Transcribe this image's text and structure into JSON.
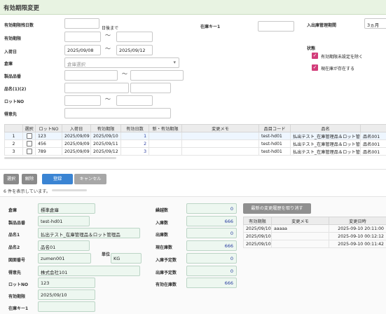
{
  "title": "有効期限変更",
  "search": {
    "remaining_days_label": "有効期限残日数",
    "remaining_days_value": "",
    "remaining_days_suffix": "日後まで",
    "expiry_label": "有効期限",
    "expiry_from": "",
    "expiry_to": "",
    "arrival_label": "入荷日",
    "arrival_from": "2025/09/08",
    "arrival_to": "2025/09/12",
    "warehouse_label": "倉庫",
    "warehouse_placeholder": "倉庫選択",
    "product_code_label": "製品品番",
    "product_name_label": "品名(1)(2)",
    "lot_label": "ロットNO",
    "customer_label": "得意先",
    "location_key_label": "在庫キー1",
    "inout_period_label": "入出庫管理期間",
    "inout_period_value": "3ヵ月",
    "status_label": "状態",
    "status_opt1": "有効期限未設定を除く",
    "status_opt2": "現在庫が存在する",
    "tilde": "〜"
  },
  "table": {
    "headers": [
      "",
      "選択",
      "ロットNO",
      "入荷日",
      "有効期限",
      "有効日数",
      "新・有効期限",
      "変更メモ",
      "品目コード",
      "品名",
      ""
    ],
    "rows": [
      {
        "no": "1",
        "lot": "123",
        "arrival": "2025/09/09",
        "expiry": "2025/09/10",
        "days": "1",
        "new_expiry": "",
        "memo": "",
        "code": "test-hd01",
        "name": "払出テスト_在庫管理品＆ロット管理品",
        "extra": "品名001"
      },
      {
        "no": "2",
        "lot": "456",
        "arrival": "2025/09/09",
        "expiry": "2025/09/11",
        "days": "2",
        "new_expiry": "",
        "memo": "",
        "code": "test-hd01",
        "name": "払出テスト_在庫管理品＆ロット管理品",
        "extra": "品名001"
      },
      {
        "no": "3",
        "lot": "789",
        "arrival": "2025/09/09",
        "expiry": "2025/09/12",
        "days": "3",
        "new_expiry": "",
        "memo": "",
        "code": "test-hd01",
        "name": "払出テスト_在庫管理品＆ロット管理品",
        "extra": "品名001"
      }
    ]
  },
  "buttons": {
    "select": "選択",
    "deselect": "解除",
    "register": "登録",
    "cancel": "キャンセル"
  },
  "count_text": "6 件を表示しています。",
  "detail": {
    "warehouse_label": "倉庫",
    "warehouse": "標準倉庫",
    "product_code_label": "製品品番",
    "product_code": "test-hd01",
    "name1_label": "品名1",
    "name1": "払出テスト_在庫管理品＆ロット管理品",
    "name2_label": "品名2",
    "name2": "品名01",
    "drawing_label": "図面番号",
    "drawing": "zumen001",
    "unit_label": "単位",
    "unit": "KG",
    "customer_label": "得意先",
    "customer": "株式会社101",
    "lot_label": "ロットNO",
    "lot": "123",
    "expiry_label": "有効期限",
    "expiry": "2025/09/10",
    "stockkey_label": "在庫キー1",
    "stockkey": "",
    "carry_label": "繰越数",
    "carry": "0",
    "in_label": "入庫数",
    "in": "666",
    "out_label": "出庫数",
    "out": "0",
    "stock_label": "現在庫数",
    "stock": "666",
    "in_plan_label": "入庫予定数",
    "in_plan": "0",
    "out_plan_label": "出庫予定数",
    "out_plan": "0",
    "valid_stock_label": "有効在庫数",
    "valid_stock": "666"
  },
  "history": {
    "button": "最新の変更履歴を取り消す",
    "headers": [
      "有効期限",
      "変更メモ",
      "変更日時"
    ],
    "rows": [
      {
        "expiry": "2025/09/10",
        "memo": "aaaaa",
        "date": "2025-09-10 20:11:00"
      },
      {
        "expiry": "2025/09/10",
        "memo": "",
        "date": "2025-09-10 00:12:12"
      },
      {
        "expiry": "2025/09/10",
        "memo": "",
        "date": "2025-09-10 00:11:42"
      }
    ]
  },
  "colors": {
    "accent": "#3a84d3",
    "check": "#d23d7a",
    "header_bg": "#e8f3e2"
  }
}
